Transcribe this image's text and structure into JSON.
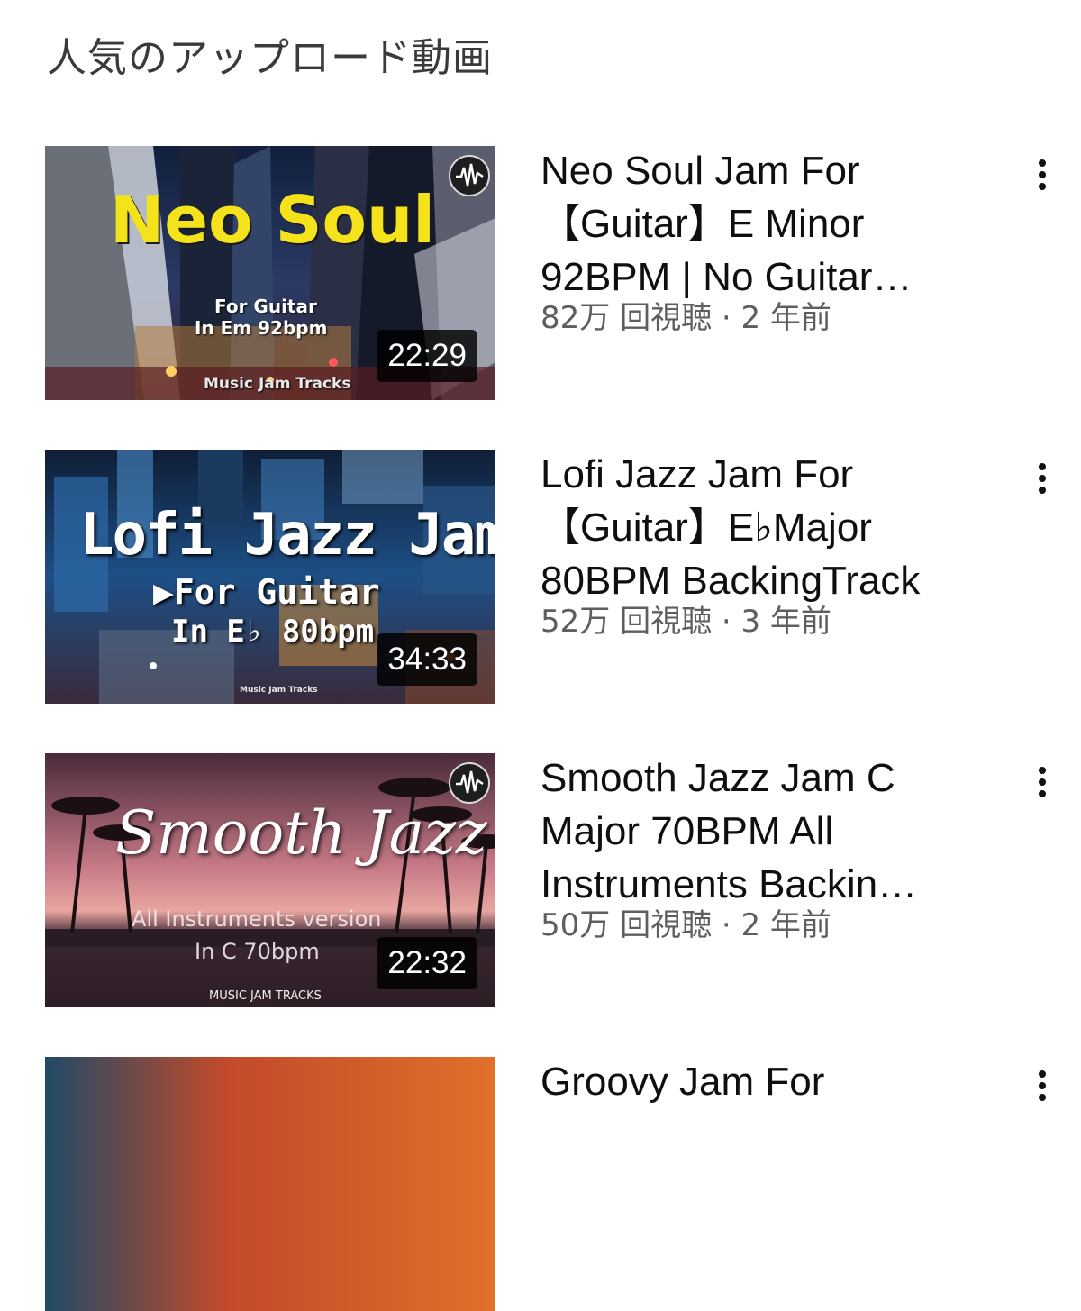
{
  "section": {
    "title": "人気のアップロード動画"
  },
  "videos": [
    {
      "thumb": {
        "main_text": "Neo Soul",
        "sub1": "For Guitar",
        "sub2": "In Em 92bpm",
        "brand": "Music Jam Tracks",
        "duration": "22:29"
      },
      "title_lines": [
        "Neo Soul Jam For",
        "【Guitar】E Minor",
        "92BPM | No Guitar…"
      ],
      "meta": "82万 回視聴 · 2 年前"
    },
    {
      "thumb": {
        "main_text": "Lofi Jazz Jam",
        "sub1": "▶For Guitar",
        "sub2": "In E♭ 80bpm",
        "brand": "Music Jam Tracks",
        "duration": "34:33"
      },
      "title_lines": [
        "Lofi Jazz Jam For",
        "【Guitar】E♭Major",
        "80BPM BackingTrack"
      ],
      "meta": "52万 回視聴 · 3 年前"
    },
    {
      "thumb": {
        "main_text": "Smooth Jazz",
        "sub1": "All Instruments version",
        "sub2": "In C 70bpm",
        "brand": "MUSIC JAM TRACKS",
        "duration": "22:32"
      },
      "title_lines": [
        "Smooth Jazz Jam C",
        "Major 70BPM All",
        "Instruments Backin…"
      ],
      "meta": "50万 回視聴 · 2 年前"
    },
    {
      "title_lines": [
        "Groovy Jam For"
      ]
    }
  ],
  "colors": {
    "neo_soul_yellow": "#f4e21a",
    "lofi_blue": "#1d4f86",
    "smooth_jazz_pink": "#c77a86"
  }
}
